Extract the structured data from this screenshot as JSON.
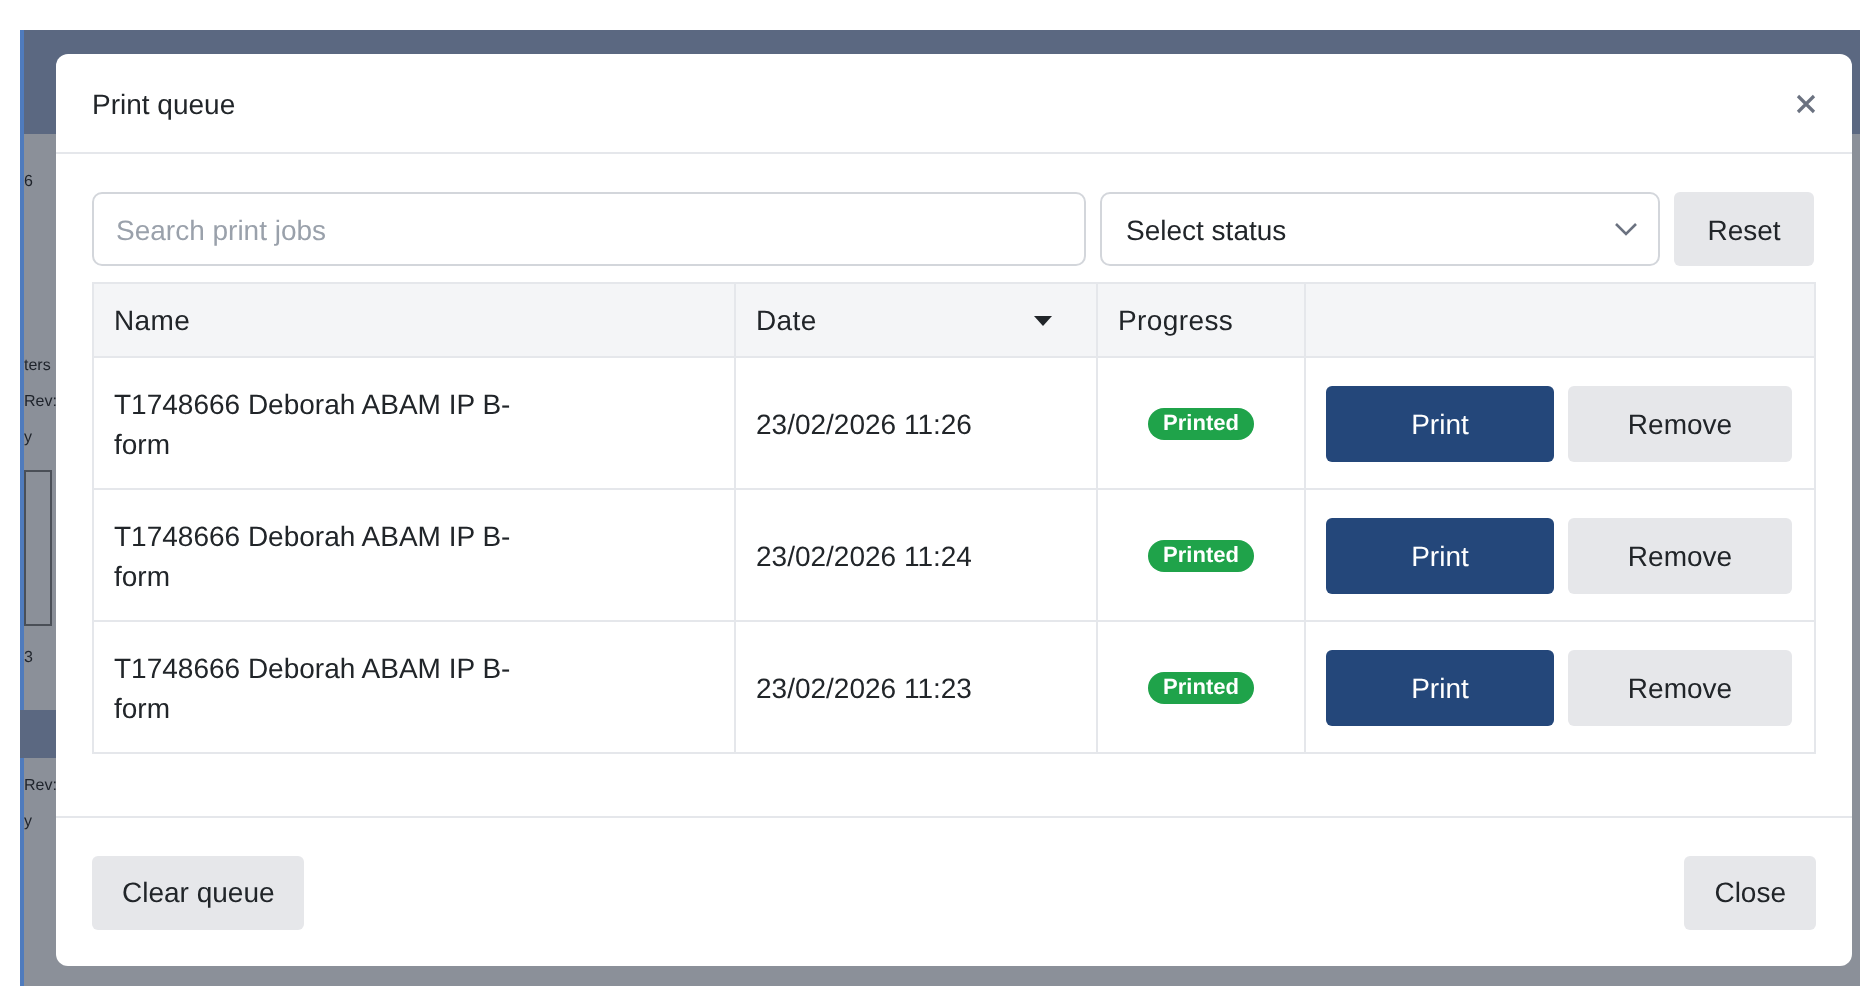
{
  "background": {
    "fragments": [
      "6",
      "ters",
      "Rev:",
      "y",
      "3",
      "Rev:",
      "y"
    ]
  },
  "dialog": {
    "title": "Print queue",
    "search": {
      "placeholder": "Search print jobs"
    },
    "status_select": {
      "value": "Select status"
    },
    "reset_button": "Reset",
    "table": {
      "columns": [
        {
          "label": "Name",
          "sorted": false
        },
        {
          "label": "Date",
          "sorted": true
        },
        {
          "label": "Progress",
          "sorted": false
        }
      ],
      "rows": [
        {
          "name": "T1748666 Deborah ABAM IP B-form",
          "date": "23/02/2026 11:26",
          "progress": "Printed",
          "actions": [
            "Print",
            "Remove"
          ]
        },
        {
          "name": "T1748666 Deborah ABAM IP B-form",
          "date": "23/02/2026 11:24",
          "progress": "Printed",
          "actions": [
            "Print",
            "Remove"
          ]
        },
        {
          "name": "T1748666 Deborah ABAM IP B-form",
          "date": "23/02/2026 11:23",
          "progress": "Printed",
          "actions": [
            "Print",
            "Remove"
          ]
        }
      ]
    },
    "footer": {
      "left_button": "Clear queue",
      "right_button": "Close"
    }
  }
}
